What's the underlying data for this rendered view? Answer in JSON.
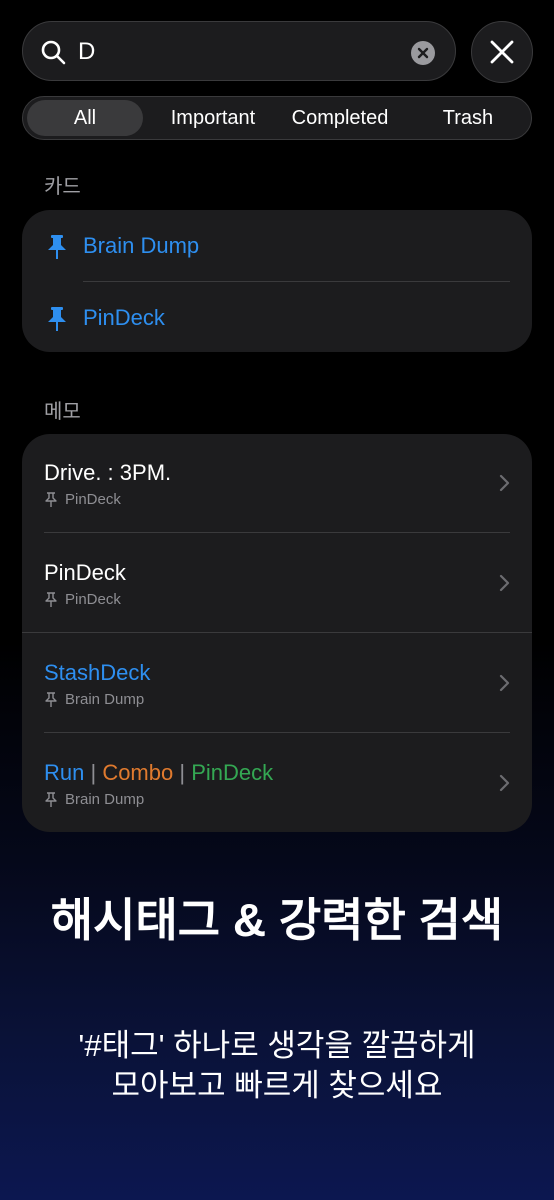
{
  "search": {
    "value": "D"
  },
  "tabs": [
    {
      "label": "All",
      "active": true
    },
    {
      "label": "Important",
      "active": false
    },
    {
      "label": "Completed",
      "active": false
    },
    {
      "label": "Trash",
      "active": false
    }
  ],
  "cards_section": {
    "label": "카드",
    "items": [
      {
        "title": "Brain Dump",
        "icon": "pin-icon"
      },
      {
        "title": "PinDeck",
        "icon": "pin-icon"
      }
    ]
  },
  "memos_section": {
    "label": "메모",
    "items": [
      {
        "title": "Drive. : 3PM.",
        "deck": "PinDeck"
      },
      {
        "title": "PinDeck",
        "deck": "PinDeck"
      },
      {
        "title": "StashDeck",
        "deck": "Brain Dump"
      },
      {
        "title_parts": [
          "Run",
          " | ",
          "Combo",
          " | ",
          "PinDeck"
        ],
        "deck": "Brain Dump"
      }
    ]
  },
  "colors": {
    "accent_blue": "#2e8ff0",
    "tag_orange": "#e07a2e",
    "tag_green": "#34a853",
    "card_bg": "#1c1c1e"
  },
  "promo": {
    "headline": "해시태그 & 강력한 검색",
    "subline_1": "'#태그' 하나로 생각을 깔끔하게",
    "subline_2": "모아보고 빠르게 찾으세요"
  }
}
